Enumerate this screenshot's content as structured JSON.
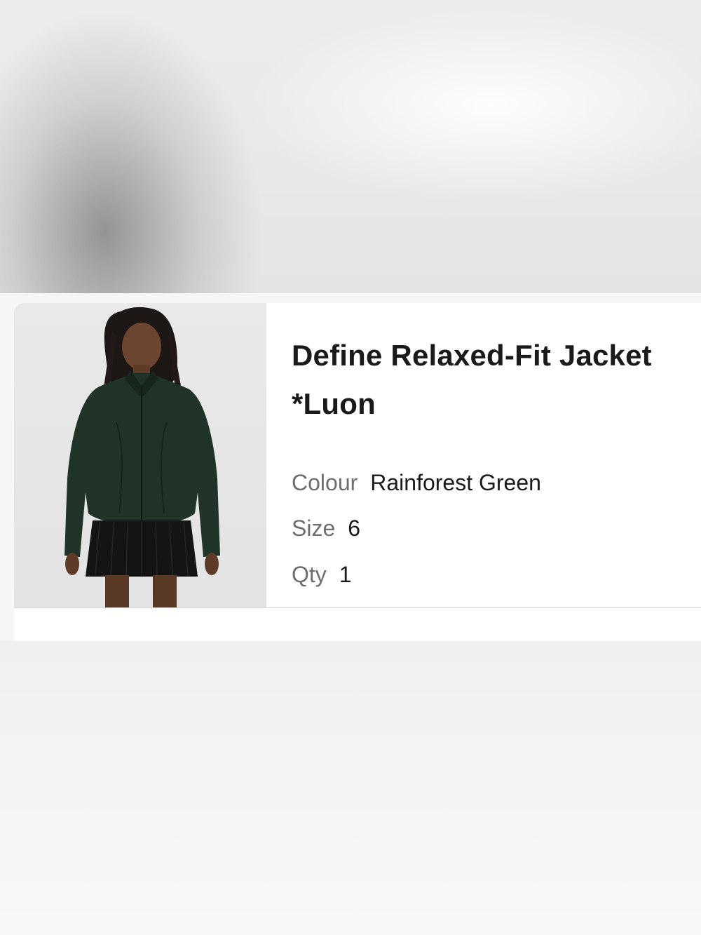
{
  "product": {
    "name": "Define Relaxed-Fit Jacket *Luon",
    "image_alt": "Model wearing jacket",
    "attributes": {
      "colour": {
        "label": "Colour",
        "value": "Rainforest Green"
      },
      "size": {
        "label": "Size",
        "value": "6"
      },
      "qty": {
        "label": "Qty",
        "value": "1"
      }
    }
  },
  "colors": {
    "jacket": "#1f3327",
    "background": "#ffffff",
    "label_text": "#6e6e6e",
    "value_text": "#1a1a1a"
  }
}
